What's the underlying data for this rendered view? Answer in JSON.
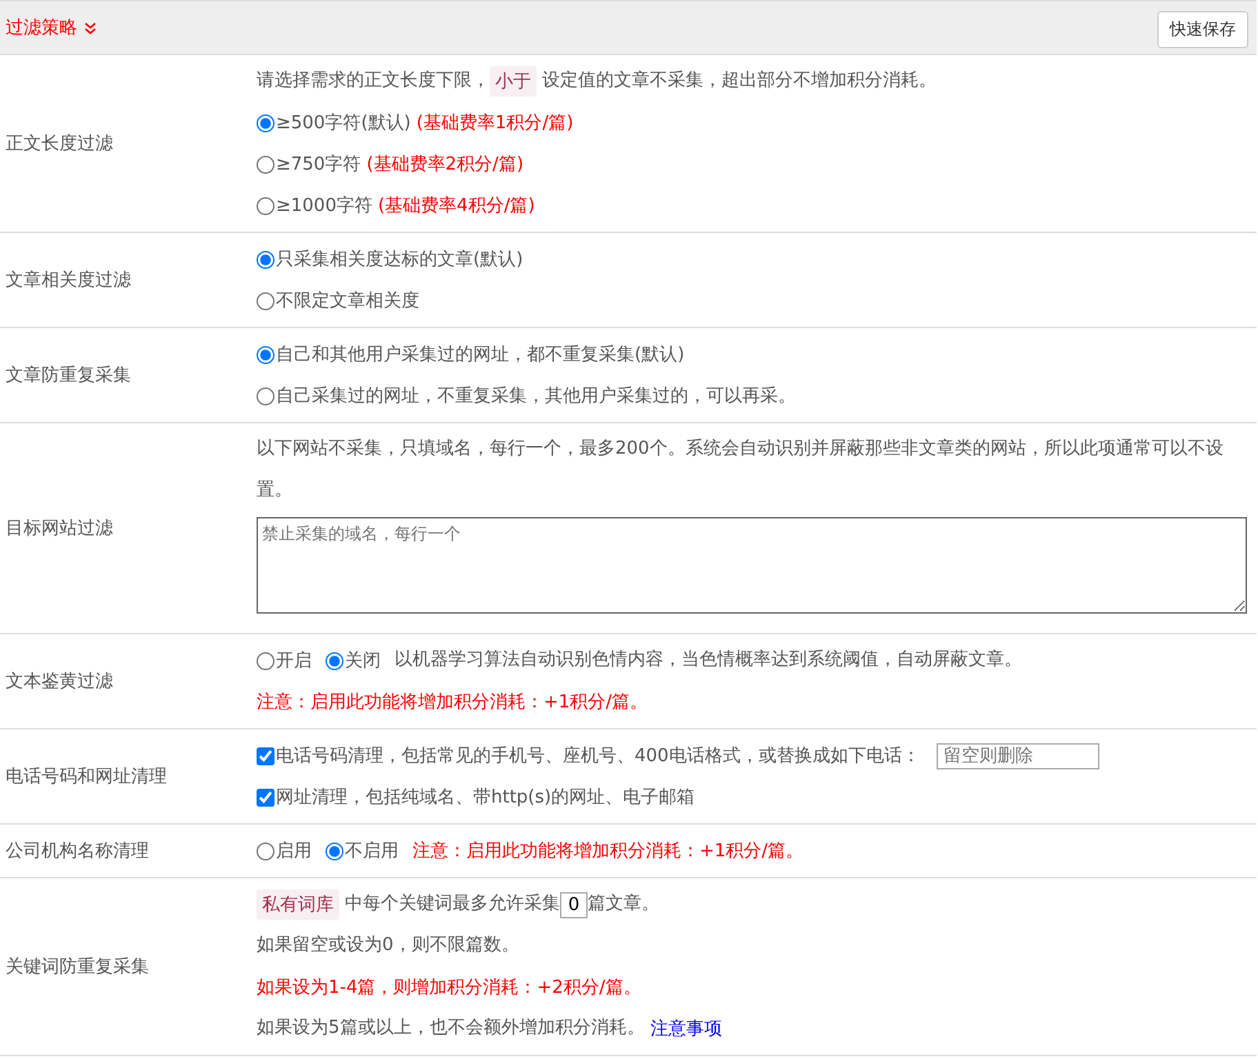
{
  "header": {
    "title": "过滤策略",
    "button": "快速保存"
  },
  "rows": [
    {
      "label": "正文长度过滤",
      "lines": [
        [
          {
            "kind": "text",
            "text": "请选择需求的正文长度下限，"
          },
          {
            "kind": "tag",
            "text": "小于"
          },
          {
            "kind": "text",
            "text": "设定值的文章不采集，超出部分不增加积分消耗。"
          }
        ],
        [
          {
            "kind": "radio",
            "label": "≥500字符(默认)",
            "note": "(基础费率1积分/篇)",
            "selected": true
          }
        ],
        [
          {
            "kind": "radio",
            "label": "≥750字符",
            "note": "(基础费率2积分/篇)",
            "selected": false
          }
        ],
        [
          {
            "kind": "radio",
            "label": "≥1000字符",
            "note": "(基础费率4积分/篇)",
            "selected": false
          }
        ]
      ]
    },
    {
      "label": "文章相关度过滤",
      "lines": [
        [
          {
            "kind": "radio",
            "label": "只采集相关度达标的文章(默认)",
            "selected": true
          }
        ],
        [
          {
            "kind": "radio",
            "label": "不限定文章相关度",
            "selected": false
          }
        ]
      ]
    },
    {
      "label": "文章防重复采集",
      "lines": [
        [
          {
            "kind": "radio",
            "label": "自己和其他用户采集过的网址，都不重复采集(默认)",
            "selected": true
          }
        ],
        [
          {
            "kind": "radio",
            "label": "自己采集过的网址，不重复采集，其他用户采集过的，可以再采。",
            "selected": false
          }
        ]
      ]
    },
    {
      "label": "目标网站过滤",
      "lines": [
        [
          {
            "kind": "text",
            "text": "以下网站不采集，只填域名，每行一个，最多200个。系统会自动识别并屏蔽那些非文章类的网站，所以此项通常可以不设置。"
          }
        ],
        [
          {
            "kind": "textarea",
            "placeholder": "禁止采集的域名，每行一个"
          }
        ]
      ]
    },
    {
      "label": "文本鉴黄过滤",
      "lines": [
        [
          {
            "kind": "radio",
            "label": "开启",
            "selected": false
          },
          {
            "kind": "radio",
            "label": "关闭",
            "selected": true
          },
          {
            "kind": "text",
            "text": "以机器学习算法自动识别色情内容，当色情概率达到系统阈值，自动屏蔽文章。"
          }
        ],
        [
          {
            "kind": "warn",
            "text": "注意：启用此功能将增加积分消耗：+1积分/篇。"
          }
        ]
      ]
    },
    {
      "label": "电话号码和网址清理",
      "lines": [
        [
          {
            "kind": "checkbox",
            "label": "电话号码清理，包括常见的手机号、座机号、400电话格式，或替换成如下电话：",
            "checked": true
          },
          {
            "kind": "input",
            "placeholder": "留空则删除"
          }
        ],
        [
          {
            "kind": "checkbox",
            "label": "网址清理，包括纯域名、带http(s)的网址、电子邮箱",
            "checked": true
          }
        ]
      ]
    },
    {
      "label": "公司机构名称清理",
      "lines": [
        [
          {
            "kind": "radio",
            "label": "启用",
            "selected": false
          },
          {
            "kind": "radio",
            "label": "不启用",
            "selected": true
          },
          {
            "kind": "warn",
            "text": "注意：启用此功能将增加积分消耗：+1积分/篇。"
          }
        ]
      ]
    },
    {
      "label": "关键词防重复采集",
      "lines": [
        [
          {
            "kind": "tag",
            "text": "私有词库"
          },
          {
            "kind": "text",
            "text": "中每个关键词最多允许采集"
          },
          {
            "kind": "number",
            "value": "0"
          },
          {
            "kind": "text",
            "text": "篇文章。"
          }
        ],
        [
          {
            "kind": "text",
            "text": "如果留空或设为0，则不限篇数。"
          }
        ],
        [
          {
            "kind": "warn",
            "text": "如果设为1-4篇，则增加积分消耗：+2积分/篇。"
          }
        ],
        [
          {
            "kind": "text",
            "text": "如果设为5篇或以上，也不会额外增加积分消耗。"
          },
          {
            "kind": "link",
            "text": "注意事项"
          }
        ]
      ]
    }
  ]
}
